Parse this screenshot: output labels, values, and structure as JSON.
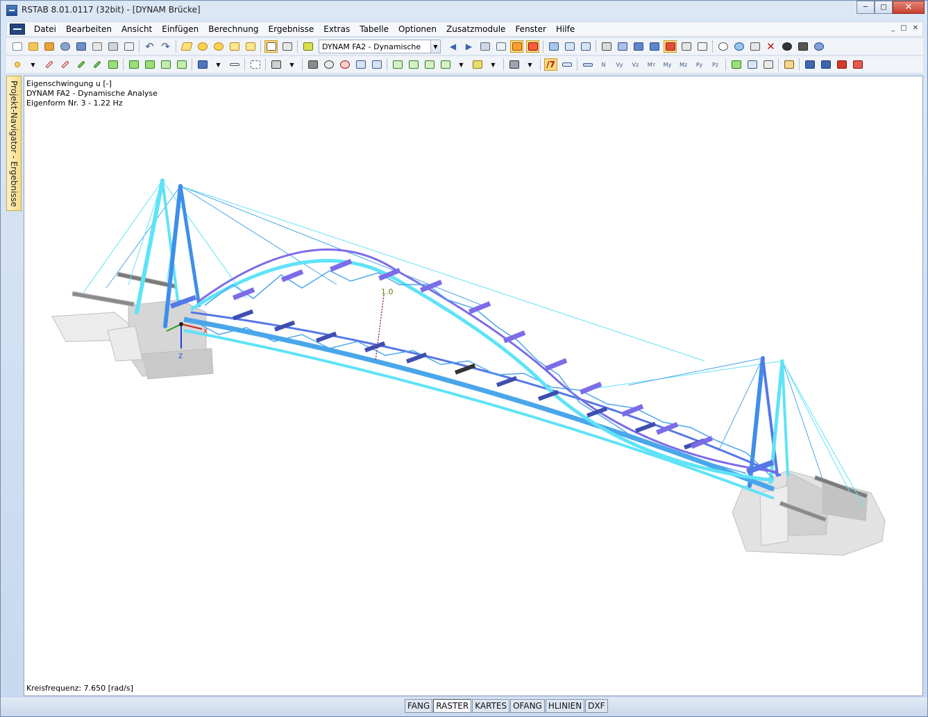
{
  "window": {
    "title": "RSTAB 8.01.0117 (32bit) - [DYNAM Brücke]",
    "minimize": "─",
    "maximize": "□",
    "close": "✕"
  },
  "menu": {
    "items": [
      "Datei",
      "Bearbeiten",
      "Ansicht",
      "Einfügen",
      "Berechnung",
      "Ergebnisse",
      "Extras",
      "Tabelle",
      "Optionen",
      "Zusatzmodule",
      "Fenster",
      "Hilfe"
    ],
    "mdi": [
      "_",
      "□",
      "✕"
    ]
  },
  "toolbar": {
    "case_select": "DYNAM FA2 - Dynamische",
    "result_labels": [
      "N",
      "Vy",
      "Vz",
      "Mт",
      "My",
      "Mz",
      "Py",
      "Pz"
    ]
  },
  "nav_panel": {
    "label": "Projekt-Navigator - Ergebnisse"
  },
  "viewport": {
    "info_lines": [
      "Eigenschwingung  u [-]",
      "DYNAM FA2 - Dynamische Analyse",
      "Eigenform Nr. 3 - 1.22 Hz"
    ],
    "frequency": "Kreisfrequenz: 7.650 [rad/s]",
    "max_label": "1.0",
    "axis_x": "X",
    "axis_z": "Z",
    "colors": {
      "light": "#5fe3f7",
      "mid": "#4aa6ea",
      "deep": "#5677e6",
      "violet": "#7c6ce8",
      "concrete": "#d8d8d8"
    }
  },
  "statusbar": {
    "tabs": [
      "FANG",
      "RASTER",
      "KARTES",
      "OFANG",
      "HLINIEN",
      "DXF"
    ],
    "active": "RASTER"
  }
}
